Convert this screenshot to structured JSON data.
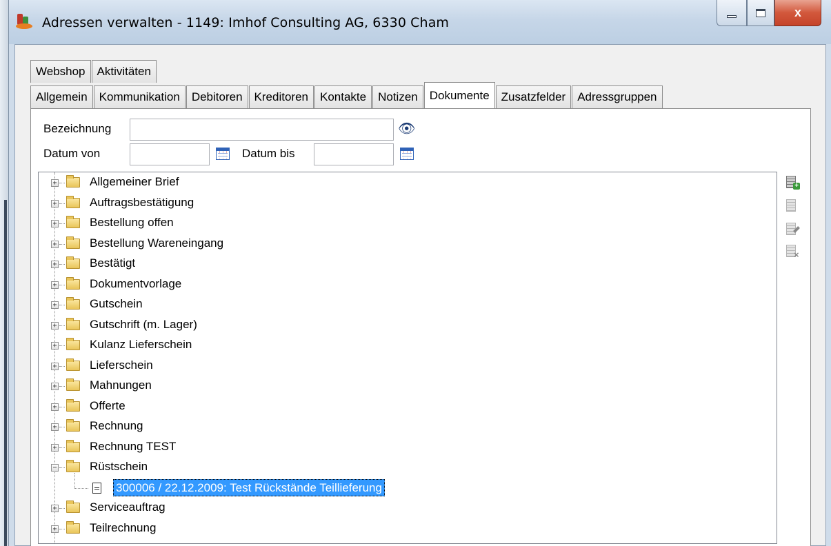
{
  "window": {
    "title": "Adressen verwalten - 1149: Imhof Consulting AG, 6330 Cham",
    "close_glyph": "x"
  },
  "tabs_row1": [
    {
      "label": "Webshop"
    },
    {
      "label": "Aktivitäten"
    }
  ],
  "tabs_row2": [
    {
      "label": "Allgemein"
    },
    {
      "label": "Kommunikation"
    },
    {
      "label": "Debitoren"
    },
    {
      "label": "Kreditoren"
    },
    {
      "label": "Kontakte"
    },
    {
      "label": "Notizen"
    },
    {
      "label": "Dokumente",
      "active": true
    },
    {
      "label": "Zusatzfelder"
    },
    {
      "label": "Adressgruppen"
    }
  ],
  "filter": {
    "bezeichnung_label": "Bezeichnung",
    "bezeichnung_value": "",
    "datum_von_label": "Datum von",
    "datum_von_value": "",
    "datum_bis_label": "Datum bis",
    "datum_bis_value": ""
  },
  "tree": {
    "items": [
      {
        "label": "Allgemeiner Brief",
        "expanded": false
      },
      {
        "label": "Auftragsbestätigung",
        "expanded": false
      },
      {
        "label": "Bestellung offen",
        "expanded": false
      },
      {
        "label": "Bestellung Wareneingang",
        "expanded": false
      },
      {
        "label": "Bestätigt",
        "expanded": false
      },
      {
        "label": "Dokumentvorlage",
        "expanded": false
      },
      {
        "label": "Gutschein",
        "expanded": false
      },
      {
        "label": "Gutschrift (m. Lager)",
        "expanded": false
      },
      {
        "label": "Kulanz Lieferschein",
        "expanded": false
      },
      {
        "label": "Lieferschein",
        "expanded": false
      },
      {
        "label": "Mahnungen",
        "expanded": false
      },
      {
        "label": "Offerte",
        "expanded": false
      },
      {
        "label": "Rechnung",
        "expanded": false
      },
      {
        "label": "Rechnung TEST",
        "expanded": false
      },
      {
        "label": "Rüstschein",
        "expanded": true
      },
      {
        "label": "300006  /  22.12.2009: Test Rückstände Teillieferung",
        "child": true,
        "selected": true
      },
      {
        "label": "Serviceauftrag",
        "expanded": false
      },
      {
        "label": "Teilrechnung",
        "expanded": false
      }
    ]
  },
  "toolbar": {
    "icons": [
      "new-document-icon",
      "copy-document-icon",
      "edit-document-icon",
      "delete-document-icon"
    ]
  },
  "colors": {
    "selection": "#3399ff",
    "close_button": "#c5432a"
  }
}
